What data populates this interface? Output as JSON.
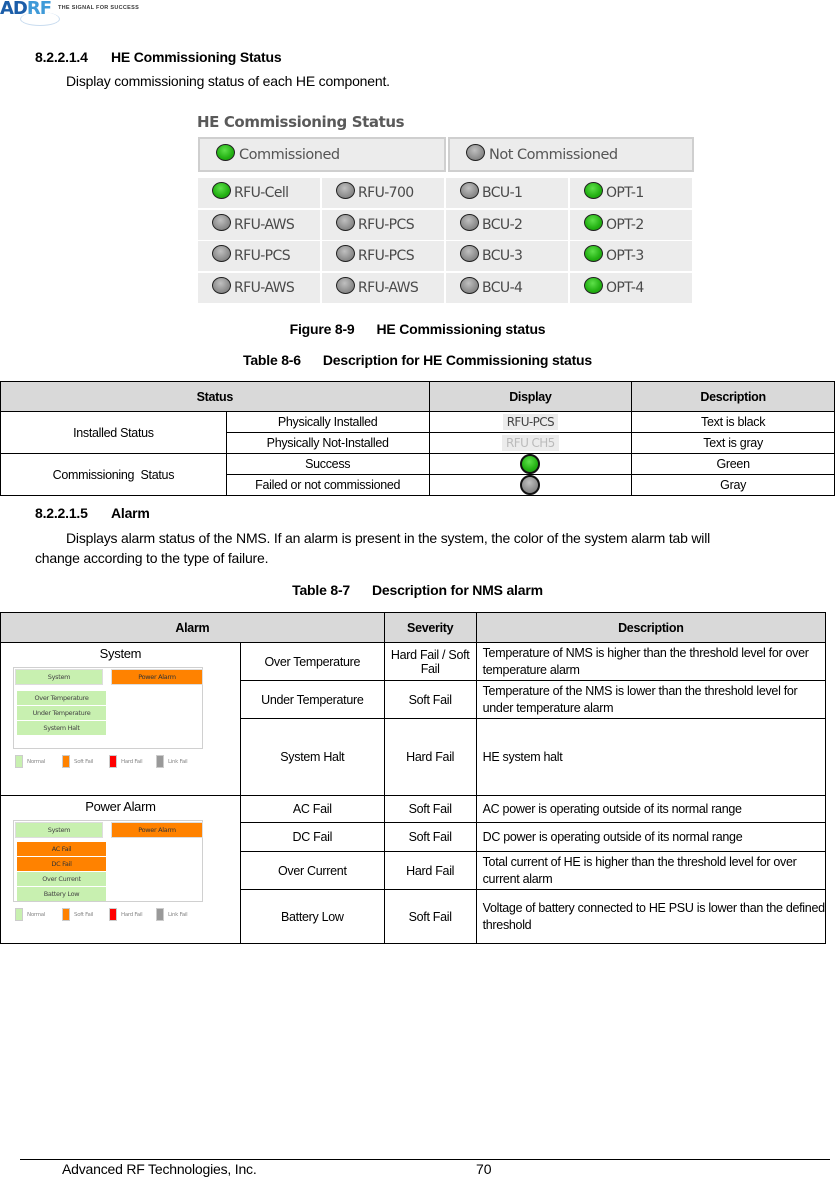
{
  "header": {
    "logo_text_main": "AD",
    "logo_text_accent": "RF",
    "logo_tagline": "THE SIGNAL FOR SUCCESS"
  },
  "section1": {
    "number": "8.2.2.1.4",
    "title": "HE Commissioning Status",
    "body": "Display commissioning status of each HE component."
  },
  "figure": {
    "title": "HE Commissioning Status",
    "legend": [
      {
        "label": "Commissioned",
        "state": "green"
      },
      {
        "label": "Not Commissioned",
        "state": "gray"
      }
    ],
    "components": [
      [
        {
          "label": "RFU-Cell",
          "state": "green"
        },
        {
          "label": "RFU-700",
          "state": "gray"
        },
        {
          "label": "BCU-1",
          "state": "gray"
        },
        {
          "label": "OPT-1",
          "state": "green"
        }
      ],
      [
        {
          "label": "RFU-AWS",
          "state": "gray"
        },
        {
          "label": "RFU-PCS",
          "state": "gray"
        },
        {
          "label": "BCU-2",
          "state": "gray"
        },
        {
          "label": "OPT-2",
          "state": "green"
        }
      ],
      [
        {
          "label": "RFU-PCS",
          "state": "gray"
        },
        {
          "label": "RFU-PCS",
          "state": "gray"
        },
        {
          "label": "BCU-3",
          "state": "gray"
        },
        {
          "label": "OPT-3",
          "state": "green"
        }
      ],
      [
        {
          "label": "RFU-AWS",
          "state": "gray"
        },
        {
          "label": "RFU-AWS",
          "state": "gray"
        },
        {
          "label": "BCU-4",
          "state": "gray"
        },
        {
          "label": "OPT-4",
          "state": "green"
        }
      ]
    ],
    "caption_label": "Figure 8-9",
    "caption_text": "HE Commissioning status"
  },
  "table1": {
    "caption_label": "Table 8-6",
    "caption_text": "Description for HE Commissioning status",
    "headers": [
      "Status",
      "Display",
      "Description"
    ],
    "groups": [
      {
        "name": "Installed Status",
        "rows": [
          {
            "status": "Physically Installed",
            "display_text": "RFU-PCS",
            "description": "Text is black"
          },
          {
            "status": "Physically Not-Installed",
            "display_text": "RFU CH5",
            "description": "Text is gray"
          }
        ]
      },
      {
        "name": "Commissioning  Status",
        "rows": [
          {
            "status": "Success",
            "display_led": "green",
            "description": "Green"
          },
          {
            "status": "Failed or not commissioned",
            "display_led": "gray",
            "description": "Gray"
          }
        ]
      }
    ]
  },
  "section2": {
    "number": "8.2.2.1.5",
    "title": "Alarm",
    "body_line1": "Displays alarm status of the NMS. If an alarm is present in the system, the color of the system alarm tab will",
    "body_line2": "change according to the type of failure."
  },
  "table2": {
    "caption_label": "Table 8-7",
    "caption_text": "Description for NMS alarm",
    "headers": [
      "Alarm",
      "Severity",
      "Description"
    ],
    "groups": [
      {
        "name": "System",
        "shot": {
          "tab_system": "System",
          "tab_power": "Power Alarm",
          "items": [
            {
              "label": "Over Temperature",
              "state": "normal"
            },
            {
              "label": "Under Temperature",
              "state": "normal"
            },
            {
              "label": "System Halt",
              "state": "normal"
            }
          ]
        },
        "rows": [
          {
            "alarm": "Over Temperature",
            "severity": "Hard Fail / Soft Fail",
            "description": "Temperature of NMS is higher than the threshold level for over temperature alarm"
          },
          {
            "alarm": "Under Temperature",
            "severity": "Soft Fail",
            "description": "Temperature of the NMS is lower than the threshold level for under temperature alarm"
          },
          {
            "alarm": "System Halt",
            "severity": "Hard Fail",
            "description": "HE system halt"
          }
        ]
      },
      {
        "name": "Power Alarm",
        "shot": {
          "tab_system": "System",
          "tab_power": "Power Alarm",
          "items": [
            {
              "label": "AC Fail",
              "state": "soft"
            },
            {
              "label": "DC Fail",
              "state": "soft"
            },
            {
              "label": "Over Current",
              "state": "normal"
            },
            {
              "label": "Battery Low",
              "state": "normal"
            }
          ]
        },
        "rows": [
          {
            "alarm": "AC Fail",
            "severity": "Soft Fail",
            "description": "AC power is operating outside of its normal range"
          },
          {
            "alarm": "DC Fail",
            "severity": "Soft Fail",
            "description": "DC power is operating outside of its normal range"
          },
          {
            "alarm": "Over Current",
            "severity": "Hard Fail",
            "description": "Total current of HE is higher than the threshold level for over current alarm"
          },
          {
            "alarm": "Battery Low",
            "severity": "Soft Fail",
            "description": "Voltage of battery connected to HE PSU is lower than the defined threshold"
          }
        ]
      }
    ],
    "legend": [
      {
        "label": "Normal",
        "color": "#c8f0b0"
      },
      {
        "label": "Soft Fail",
        "color": "#ff8200"
      },
      {
        "label": "Hard Fail",
        "color": "#ff0000"
      },
      {
        "label": "Link Fail",
        "color": "#999999"
      }
    ]
  },
  "colors": {
    "commissioned": "#22b012",
    "not_commissioned": "#8e8e8e",
    "normal": "#c8f0b0",
    "soft_fail": "#ff8200",
    "hard_fail": "#ff0000",
    "link_fail": "#999999"
  },
  "footer": {
    "company": "Advanced RF Technologies, Inc.",
    "page": "70"
  }
}
